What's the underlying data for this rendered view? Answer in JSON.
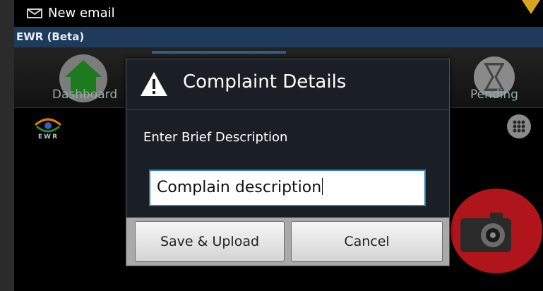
{
  "statusbar": {
    "notification": "New email"
  },
  "app": {
    "title": "EWR (Beta)"
  },
  "tabs": [
    {
      "label": "Dashboard",
      "icon": "home-icon"
    },
    {
      "label": "Pending",
      "icon": "hourglass-icon"
    }
  ],
  "logo": {
    "text": "EWR"
  },
  "dialog": {
    "title": "Complaint Details",
    "prompt": "Enter Brief Description",
    "input_value": "Complain description",
    "save_label": "Save & Upload",
    "cancel_label": "Cancel"
  },
  "colors": {
    "title_bar": "#1e3b5c",
    "home_green": "#1d7a1d",
    "camera_red": "#b0151b",
    "input_border": "#2a80c0"
  }
}
